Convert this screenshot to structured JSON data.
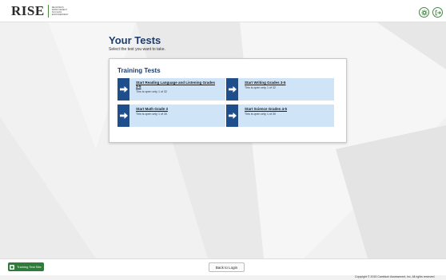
{
  "header": {
    "logo_text": "RISE",
    "logo_subtext": "READINESS IMPROVEMENT SUCCESS EMPOWERMENT",
    "settings_icon": "gear-icon",
    "logout_icon": "sign-out-icon",
    "accent_color": "#3f8a3d"
  },
  "main": {
    "title": "Your Tests",
    "subtitle": "Select the test you want to take."
  },
  "panel": {
    "title": "Training Tests",
    "tiles": [
      {
        "label": "Start Reading Language and Listening Grades 3-5",
        "note": "This is open only 1 of 32",
        "icon": "arrow-right-icon"
      },
      {
        "label": "Start Writing Grades 3-5",
        "note": "This is open only 1 of 32",
        "icon": "arrow-right-icon"
      },
      {
        "label": "Start Math Grade 3",
        "note": "This is open only 1 of 30",
        "icon": "arrow-right-icon"
      },
      {
        "label": "Start Science Grades 4-5",
        "note": "This is open only 1 of 30",
        "icon": "arrow-right-icon"
      }
    ]
  },
  "footer": {
    "tts_label": "Training Test Site",
    "back_label": "Back to Login",
    "copyright": "Copyright © 2015 Cambium Assessment, Inc. All rights reserved."
  },
  "colors": {
    "title": "#1d3c6e",
    "tile_bg": "#cfe4f7",
    "tile_icon": "#1f4e8c",
    "tts_button": "#2e7b3a"
  }
}
